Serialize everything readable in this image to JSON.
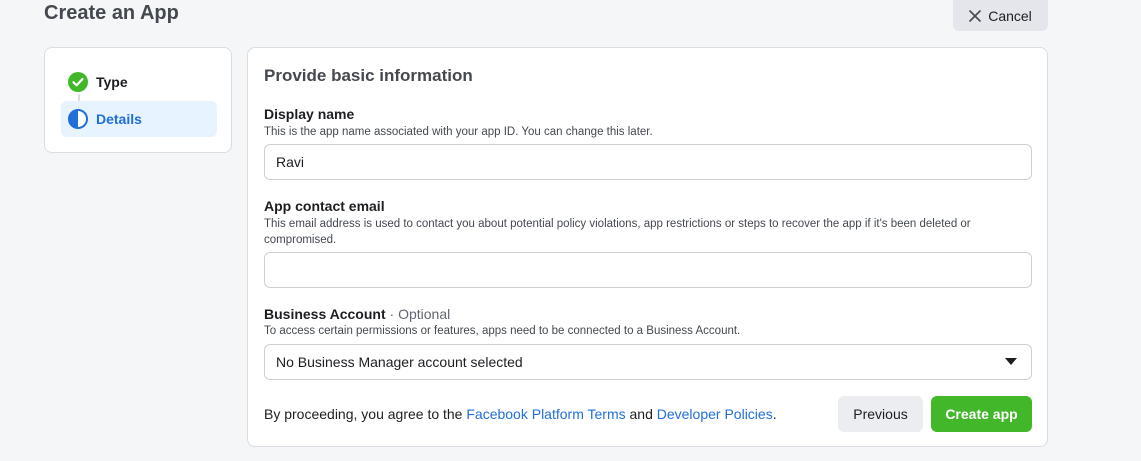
{
  "header": {
    "title": "Create an App",
    "cancel_label": "Cancel"
  },
  "steps": [
    {
      "label": "Type",
      "status": "complete",
      "icon": "check-circle-icon"
    },
    {
      "label": "Details",
      "status": "in-progress",
      "icon": "half-circle-icon"
    }
  ],
  "form": {
    "title": "Provide basic information",
    "display_name": {
      "label": "Display name",
      "help": "This is the app name associated with your app ID. You can change this later.",
      "value": "Ravi"
    },
    "contact_email": {
      "label": "App contact email",
      "help": "This email address is used to contact you about potential policy violations, app restrictions or steps to recover the app if it's been deleted or compromised.",
      "value": ""
    },
    "business_account": {
      "label": "Business Account",
      "optional": " · Optional",
      "help": "To access certain permissions or features, apps need to be connected to a Business Account.",
      "selected": "No Business Manager account selected"
    },
    "terms": {
      "prefix": "By proceeding, you agree to the ",
      "link1": "Facebook Platform Terms",
      "middle": " and ",
      "link2": "Developer Policies",
      "suffix": "."
    },
    "previous_label": "Previous",
    "create_label": "Create app"
  },
  "colors": {
    "accent_blue": "#216fdb",
    "success_green": "#42b72a",
    "step_active_bg": "#e7f3ff"
  }
}
